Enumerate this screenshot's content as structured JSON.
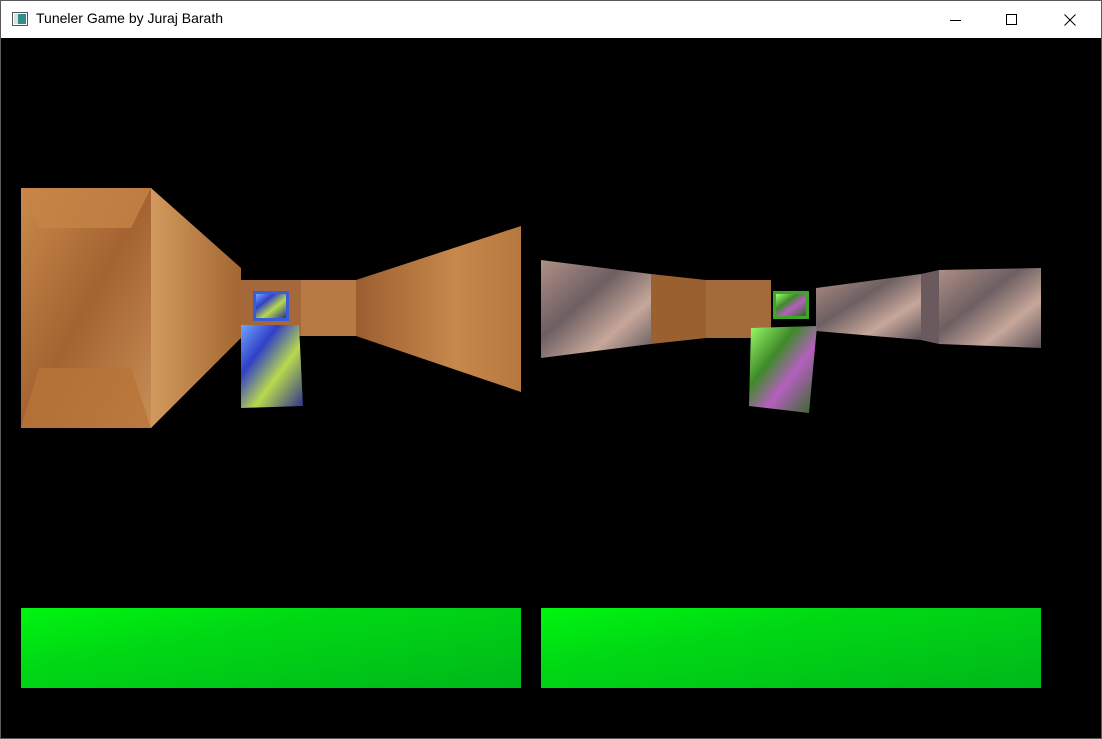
{
  "window": {
    "title": "Tuneler Game by Juraj Barath",
    "icon": "app-window-icon",
    "controls": [
      "minimize-icon",
      "maximize-icon",
      "close-icon"
    ]
  },
  "players": [
    {
      "view": "left",
      "wall_style": "sandstone",
      "tank_color": "#3a5cd8",
      "energy_fill": 1.0,
      "bar_color": "#00e014"
    },
    {
      "view": "right",
      "wall_style": "cobblestone",
      "tank_color": "#3fa52a",
      "energy_fill": 1.0,
      "bar_color": "#00e014"
    }
  ]
}
